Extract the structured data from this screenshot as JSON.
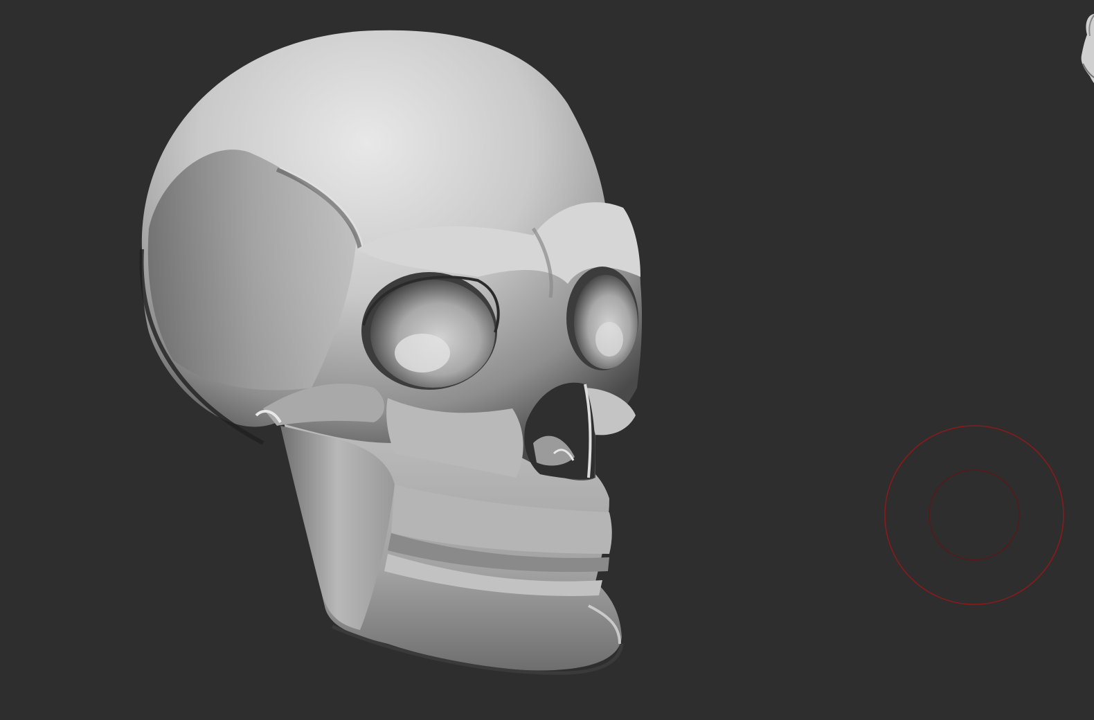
{
  "viewport": {
    "background_color": "#2e2e2e",
    "model": {
      "name": "skull-sculpt",
      "material_color": "#c8c8c8"
    },
    "brush_cursor": {
      "outer_color": "#8b1a1a",
      "inner_color": "#5a1818"
    },
    "navigation_widget": {
      "icon": "mannequin-head-icon"
    }
  }
}
